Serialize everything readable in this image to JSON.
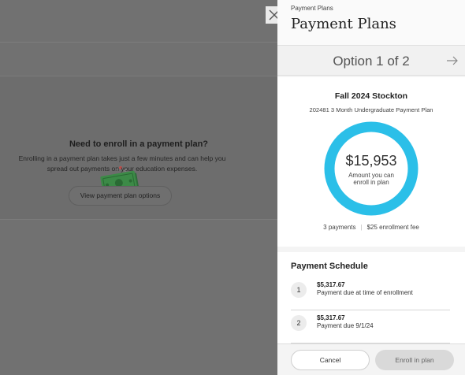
{
  "background": {
    "empty_state": {
      "title": "Need to enroll in a payment plan?",
      "description_line1": "Enrolling in a payment plan takes just a few minutes and can help you",
      "description_line2": "spread out payments on your education expenses.",
      "button_label": "View payment plan options",
      "illustration": "money-bill-icon"
    }
  },
  "drawer": {
    "close_icon": "close-icon",
    "kicker": "Payment Plans",
    "title": "Payment Plans",
    "option": {
      "label": "Option 1 of 2",
      "next_icon": "arrow-right-icon"
    },
    "plan": {
      "term": "Fall 2024 Stockton",
      "name": "202481 3 Month Undergraduate Payment Plan",
      "amount": "$15,953",
      "amount_caption_line1": "Amount you can",
      "amount_caption_line2": "enroll in plan",
      "payments": "3 payments",
      "fee": "$25 enrollment fee",
      "ring_color": "#2bbfe8"
    },
    "schedule": {
      "title": "Payment Schedule",
      "items": [
        {
          "number": "1",
          "amount": "$5,317.67",
          "description": "Payment due at time of enrollment"
        },
        {
          "number": "2",
          "amount": "$5,317.67",
          "description": "Payment due 9/1/24"
        }
      ]
    },
    "footer": {
      "cancel_label": "Cancel",
      "enroll_label": "Enroll in plan"
    }
  }
}
